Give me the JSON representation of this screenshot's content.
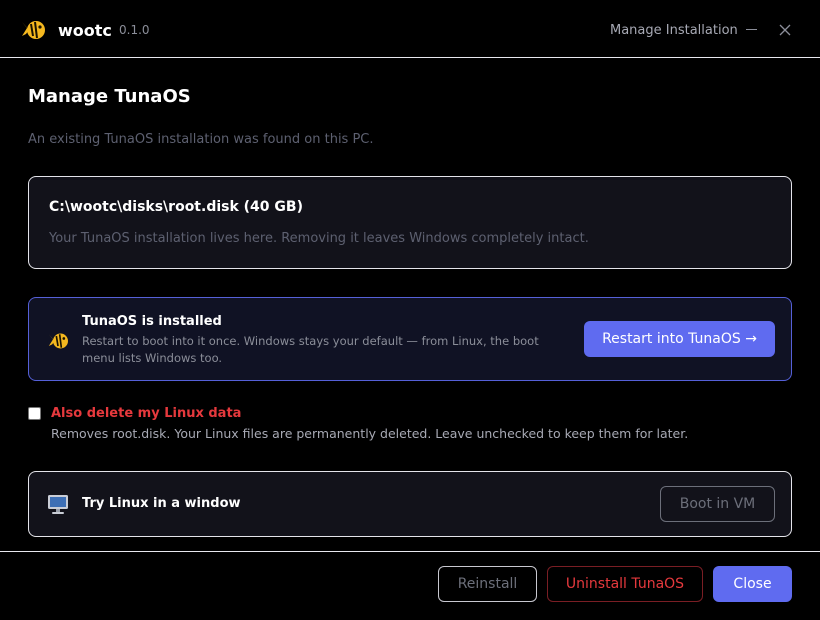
{
  "titlebar": {
    "app_name": "wootc",
    "version": "0.1.0",
    "window_title": "Manage Installation",
    "logo_icon": "fish-icon"
  },
  "page": {
    "title": "Manage TunaOS",
    "subtitle": "An existing TunaOS installation was found on this PC."
  },
  "disk": {
    "path": "C:\\wootc\\disks\\root.disk (40 GB)",
    "description": "Your TunaOS installation lives here. Removing it leaves Windows completely intact."
  },
  "install_status": {
    "icon": "fish-icon",
    "title": "TunaOS is installed",
    "description": "Restart to boot into it once. Windows stays your default — from Linux, the boot menu lists Windows too.",
    "restart_label": "Restart into TunaOS →"
  },
  "delete_option": {
    "checked": false,
    "label": "Also delete my Linux data",
    "description": "Removes root.disk. Your Linux files are permanently deleted. Leave unchecked to keep them for later."
  },
  "vm": {
    "icon": "monitor-icon",
    "title": "Try Linux in a window",
    "button_label": "Boot in VM"
  },
  "footer": {
    "reinstall_label": "Reinstall",
    "uninstall_label": "Uninstall TunaOS",
    "close_label": "Close"
  },
  "colors": {
    "accent": "#5f6bf0",
    "danger": "#e6393d",
    "fish": "#f5b81f"
  }
}
